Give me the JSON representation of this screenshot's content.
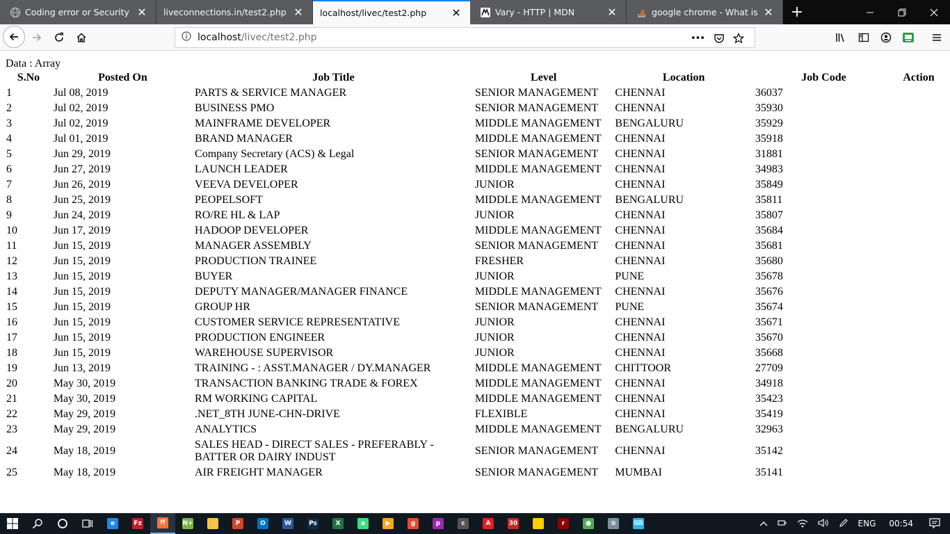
{
  "browser": {
    "tabs": [
      {
        "title": "Coding error or Security Certific",
        "favicon": "globe-icon",
        "active": false
      },
      {
        "title": "liveconnections.in/test2.php",
        "favicon": "none",
        "active": false
      },
      {
        "title": "localhost/livec/test2.php",
        "favicon": "none",
        "active": true
      },
      {
        "title": "Vary - HTTP | MDN",
        "favicon": "mdn-icon",
        "active": false
      },
      {
        "title": "google chrome - What is the \"I",
        "favicon": "stackoverflow-icon",
        "active": false
      }
    ],
    "new_tab": "+",
    "close_glyph": "✕",
    "url_host": "localhost",
    "url_path": "/livec/test2.php",
    "page_actions_glyph": "•••",
    "accent_color": "#0a84ff"
  },
  "page": {
    "debug_text": "Data : Array",
    "columns": [
      "S.No",
      "Posted On",
      "Job Title",
      "Level",
      "Location",
      "Job Code",
      "Action"
    ],
    "rows": [
      {
        "sno": "1",
        "posted": "Jul 08, 2019",
        "title": "PARTS & SERVICE MANAGER",
        "level": "SENIOR MANAGEMENT",
        "location": "CHENNAI",
        "code": "36037"
      },
      {
        "sno": "2",
        "posted": "Jul 02, 2019",
        "title": "BUSINESS PMO",
        "level": "SENIOR MANAGEMENT",
        "location": "CHENNAI",
        "code": "35930"
      },
      {
        "sno": "3",
        "posted": "Jul 02, 2019",
        "title": "MAINFRAME DEVELOPER",
        "level": "MIDDLE MANAGEMENT",
        "location": "BENGALURU",
        "code": "35929"
      },
      {
        "sno": "4",
        "posted": "Jul 01, 2019",
        "title": "BRAND MANAGER",
        "level": "MIDDLE MANAGEMENT",
        "location": "CHENNAI",
        "code": "35918"
      },
      {
        "sno": "5",
        "posted": "Jun 29, 2019",
        "title": "Company Secretary (ACS) & Legal",
        "level": "SENIOR MANAGEMENT",
        "location": "CHENNAI",
        "code": "31881"
      },
      {
        "sno": "6",
        "posted": "Jun 27, 2019",
        "title": "LAUNCH LEADER",
        "level": "MIDDLE MANAGEMENT",
        "location": "CHENNAI",
        "code": "34983"
      },
      {
        "sno": "7",
        "posted": "Jun 26, 2019",
        "title": "VEEVA DEVELOPER",
        "level": "JUNIOR",
        "location": "CHENNAI",
        "code": "35849"
      },
      {
        "sno": "8",
        "posted": "Jun 25, 2019",
        "title": "PEOPELSOFT",
        "level": "MIDDLE MANAGEMENT",
        "location": "BENGALURU",
        "code": "35811"
      },
      {
        "sno": "9",
        "posted": "Jun 24, 2019",
        "title": "RO/RE HL & LAP",
        "level": "JUNIOR",
        "location": "CHENNAI",
        "code": "35807"
      },
      {
        "sno": "10",
        "posted": "Jun 17, 2019",
        "title": "HADOOP DEVELOPER",
        "level": "MIDDLE MANAGEMENT",
        "location": "CHENNAI",
        "code": "35684"
      },
      {
        "sno": "11",
        "posted": "Jun 15, 2019",
        "title": "MANAGER ASSEMBLY",
        "level": "SENIOR MANAGEMENT",
        "location": "CHENNAI",
        "code": "35681"
      },
      {
        "sno": "12",
        "posted": "Jun 15, 2019",
        "title": "PRODUCTION TRAINEE",
        "level": "FRESHER",
        "location": "CHENNAI",
        "code": "35680"
      },
      {
        "sno": "13",
        "posted": "Jun 15, 2019",
        "title": "BUYER",
        "level": "JUNIOR",
        "location": "PUNE",
        "code": "35678"
      },
      {
        "sno": "14",
        "posted": "Jun 15, 2019",
        "title": "DEPUTY MANAGER/MANAGER FINANCE",
        "level": "MIDDLE MANAGEMENT",
        "location": "CHENNAI",
        "code": "35676"
      },
      {
        "sno": "15",
        "posted": "Jun 15, 2019",
        "title": "GROUP HR",
        "level": "SENIOR MANAGEMENT",
        "location": "PUNE",
        "code": "35674"
      },
      {
        "sno": "16",
        "posted": "Jun 15, 2019",
        "title": "CUSTOMER SERVICE REPRESENTATIVE",
        "level": "JUNIOR",
        "location": "CHENNAI",
        "code": "35671"
      },
      {
        "sno": "17",
        "posted": "Jun 15, 2019",
        "title": "PRODUCTION ENGINEER",
        "level": "JUNIOR",
        "location": "CHENNAI",
        "code": "35670"
      },
      {
        "sno": "18",
        "posted": "Jun 15, 2019",
        "title": "WAREHOUSE SUPERVISOR",
        "level": "JUNIOR",
        "location": "CHENNAI",
        "code": "35668"
      },
      {
        "sno": "19",
        "posted": "Jun 13, 2019",
        "title": "TRAINING - : ASST.MANAGER / DY.MANAGER",
        "level": "MIDDLE MANAGEMENT",
        "location": "CHITTOOR",
        "code": "27709"
      },
      {
        "sno": "20",
        "posted": "May 30, 2019",
        "title": "TRANSACTION BANKING TRADE & FOREX",
        "level": "MIDDLE MANAGEMENT",
        "location": "CHENNAI",
        "code": "34918"
      },
      {
        "sno": "21",
        "posted": "May 30, 2019",
        "title": "RM WORKING CAPITAL",
        "level": "MIDDLE MANAGEMENT",
        "location": "CHENNAI",
        "code": "35423"
      },
      {
        "sno": "22",
        "posted": "May 29, 2019",
        "title": ".NET_8TH JUNE-CHN-DRIVE",
        "level": "FLEXIBLE",
        "location": "CHENNAI",
        "code": "35419"
      },
      {
        "sno": "23",
        "posted": "May 29, 2019",
        "title": "ANALYTICS",
        "level": "MIDDLE MANAGEMENT",
        "location": "BENGALURU",
        "code": "32963"
      },
      {
        "sno": "24",
        "posted": "May 18, 2019",
        "title": "SALES HEAD - DIRECT SALES - PREFERABLY - BATTER OR DAIRY INDUST",
        "level": "SENIOR MANAGEMENT",
        "location": "CHENNAI",
        "code": "35142"
      },
      {
        "sno": "25",
        "posted": "May 18, 2019",
        "title": "AIR FREIGHT MANAGER",
        "level": "SENIOR MANAGEMENT",
        "location": "MUMBAI",
        "code": "35141"
      }
    ]
  },
  "taskbar": {
    "apps": [
      {
        "name": "edge",
        "label": "e",
        "color": "#1e88e5"
      },
      {
        "name": "filezilla",
        "label": "Fz",
        "color": "#bf1e2e"
      },
      {
        "name": "firefox",
        "label": "ff",
        "color": "#ff7139",
        "active": true
      },
      {
        "name": "notepad-plus",
        "label": "N+",
        "color": "#7cb342"
      },
      {
        "name": "file-explorer",
        "label": "",
        "color": "#f6c342"
      },
      {
        "name": "powerpoint",
        "label": "P",
        "color": "#d24726"
      },
      {
        "name": "outlook",
        "label": "O",
        "color": "#0072c6"
      },
      {
        "name": "word",
        "label": "W",
        "color": "#2b579a"
      },
      {
        "name": "photoshop",
        "label": "Ps",
        "color": "#0c2d48"
      },
      {
        "name": "excel",
        "label": "X",
        "color": "#217346"
      },
      {
        "name": "android-studio",
        "label": "a",
        "color": "#3ddc84"
      },
      {
        "name": "media-player",
        "label": "▶",
        "color": "#f5a623"
      },
      {
        "name": "git-tool",
        "label": "g",
        "color": "#e44c30"
      },
      {
        "name": "paint",
        "label": "p",
        "color": "#9c27b0"
      },
      {
        "name": "cat-app",
        "label": "c",
        "color": "#555555"
      },
      {
        "name": "acrobat",
        "label": "A",
        "color": "#e21f1f"
      },
      {
        "name": "calendar-app",
        "label": "30",
        "color": "#c62828"
      },
      {
        "name": "sticky-notes",
        "label": "",
        "color": "#ffcc00"
      },
      {
        "name": "security-app",
        "label": "r",
        "color": "#8e0000"
      },
      {
        "name": "chrome",
        "label": "●",
        "color": "#4caf50"
      },
      {
        "name": "notepad",
        "label": "≡",
        "color": "#78909c"
      },
      {
        "name": "keyboard-app",
        "label": "⌨",
        "color": "#29b6f6"
      }
    ],
    "language": "ENG",
    "time": "00:54"
  }
}
